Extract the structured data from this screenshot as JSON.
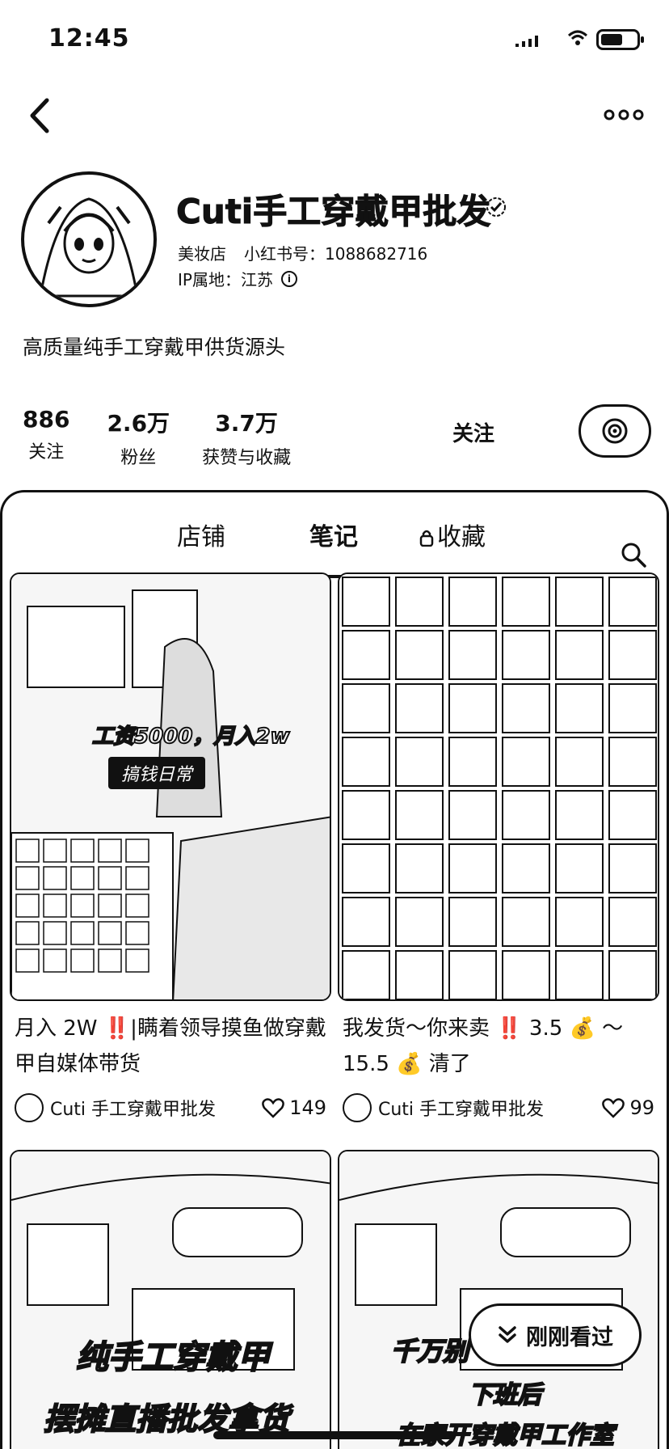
{
  "status_bar": {
    "time": "12:45"
  },
  "profile": {
    "name": "Cuti手工穿戴甲批发",
    "shop_type": "美妆店",
    "id_label": "小红书号：1088682716",
    "ip_label": "IP属地：江苏",
    "bio": "高质量纯手工穿戴甲供货源头",
    "stats": [
      {
        "value": "886",
        "label": "关注"
      },
      {
        "value": "2.6万",
        "label": "粉丝"
      },
      {
        "value": "3.7万",
        "label": "获赞与收藏"
      }
    ],
    "follow_label": "关注"
  },
  "tabs": [
    {
      "label": "店铺"
    },
    {
      "label": "笔记"
    },
    {
      "label": "收藏"
    }
  ],
  "notes": [
    {
      "title": "月入 2W ‼️|瞒着领导摸鱼做穿戴甲自媒体带货",
      "overlay_top": "工资5000，月入2w",
      "overlay_tag": "搞钱日常",
      "author": "Cuti 手工穿戴甲批发",
      "likes": "149"
    },
    {
      "title": "我发货～你来卖 ‼️ 3.5 💰 ～ 15.5 💰 清了",
      "author": "Cuti 手工穿戴甲批发",
      "likes": "99"
    },
    {
      "overlay_line1": "纯手工穿戴甲",
      "overlay_line2": "摆摊直播批发拿货"
    },
    {
      "overlay_line1": "千万别",
      "overlay_line2": "下班后",
      "overlay_line3": "在家开穿戴甲工作室"
    }
  ],
  "float_button": {
    "label": "刚刚看过"
  },
  "icons": [
    "back-icon",
    "more-icon",
    "verified-icon",
    "info-icon",
    "message-icon",
    "lock-icon",
    "search-icon",
    "heart-icon",
    "double-chevron-down-icon"
  ]
}
